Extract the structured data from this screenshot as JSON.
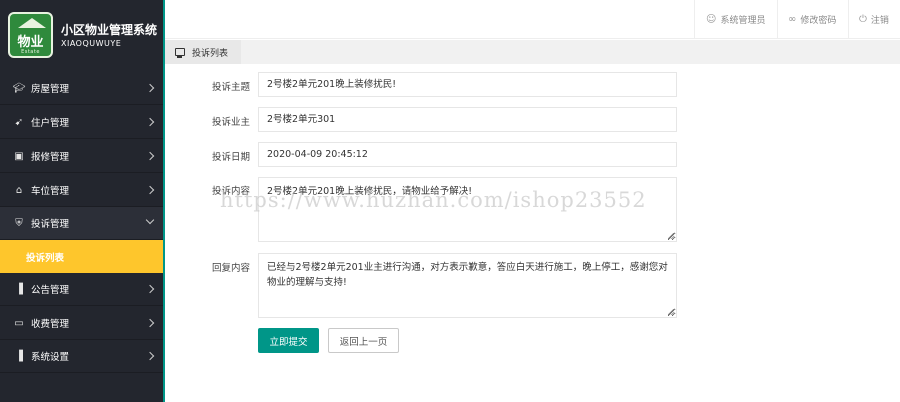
{
  "app": {
    "title": "小区物业管理系统",
    "subtitle": "XIAOQUWUYE",
    "logo_text": "物业",
    "logo_sub": "Estate"
  },
  "header": {
    "user_label": "系统管理员",
    "password_label": "修改密码",
    "logout_label": "注销"
  },
  "sidebar": {
    "items": [
      {
        "label": "房屋管理",
        "icon": "graduation-cap-icon"
      },
      {
        "label": "住户管理",
        "icon": "rocket-icon"
      },
      {
        "label": "报修管理",
        "icon": "repair-icon"
      },
      {
        "label": "车位管理",
        "icon": "car-icon"
      },
      {
        "label": "投诉管理",
        "icon": "shield-icon"
      },
      {
        "label": "公告管理",
        "icon": "bar-chart-icon"
      },
      {
        "label": "收费管理",
        "icon": "inbox-icon"
      },
      {
        "label": "系统设置",
        "icon": "bar-chart-icon"
      }
    ],
    "active_sub": "投诉列表"
  },
  "tabs": [
    {
      "label": "投诉列表",
      "icon": "monitor-icon"
    }
  ],
  "form": {
    "subject_label": "投诉主题",
    "subject_value": "2号楼2单元201晚上装修扰民!",
    "owner_label": "投诉业主",
    "owner_value": "2号楼2单元301",
    "date_label": "投诉日期",
    "date_value": "2020-04-09 20:45:12",
    "content_label": "投诉内容",
    "content_value": "2号楼2单元201晚上装修扰民，请物业给予解决!",
    "reply_label": "回复内容",
    "reply_value": "已经与2号楼2单元201业主进行沟通，对方表示歉意，答应白天进行施工，晚上停工，感谢您对物业的理解与支持!",
    "submit_label": "立即提交",
    "back_label": "返回上一页"
  },
  "watermark": "https://www.huzhan.com/ishop23552",
  "colors": {
    "sidebar_bg": "#23262e",
    "accent": "#009688",
    "active_sub": "#fec62c"
  }
}
